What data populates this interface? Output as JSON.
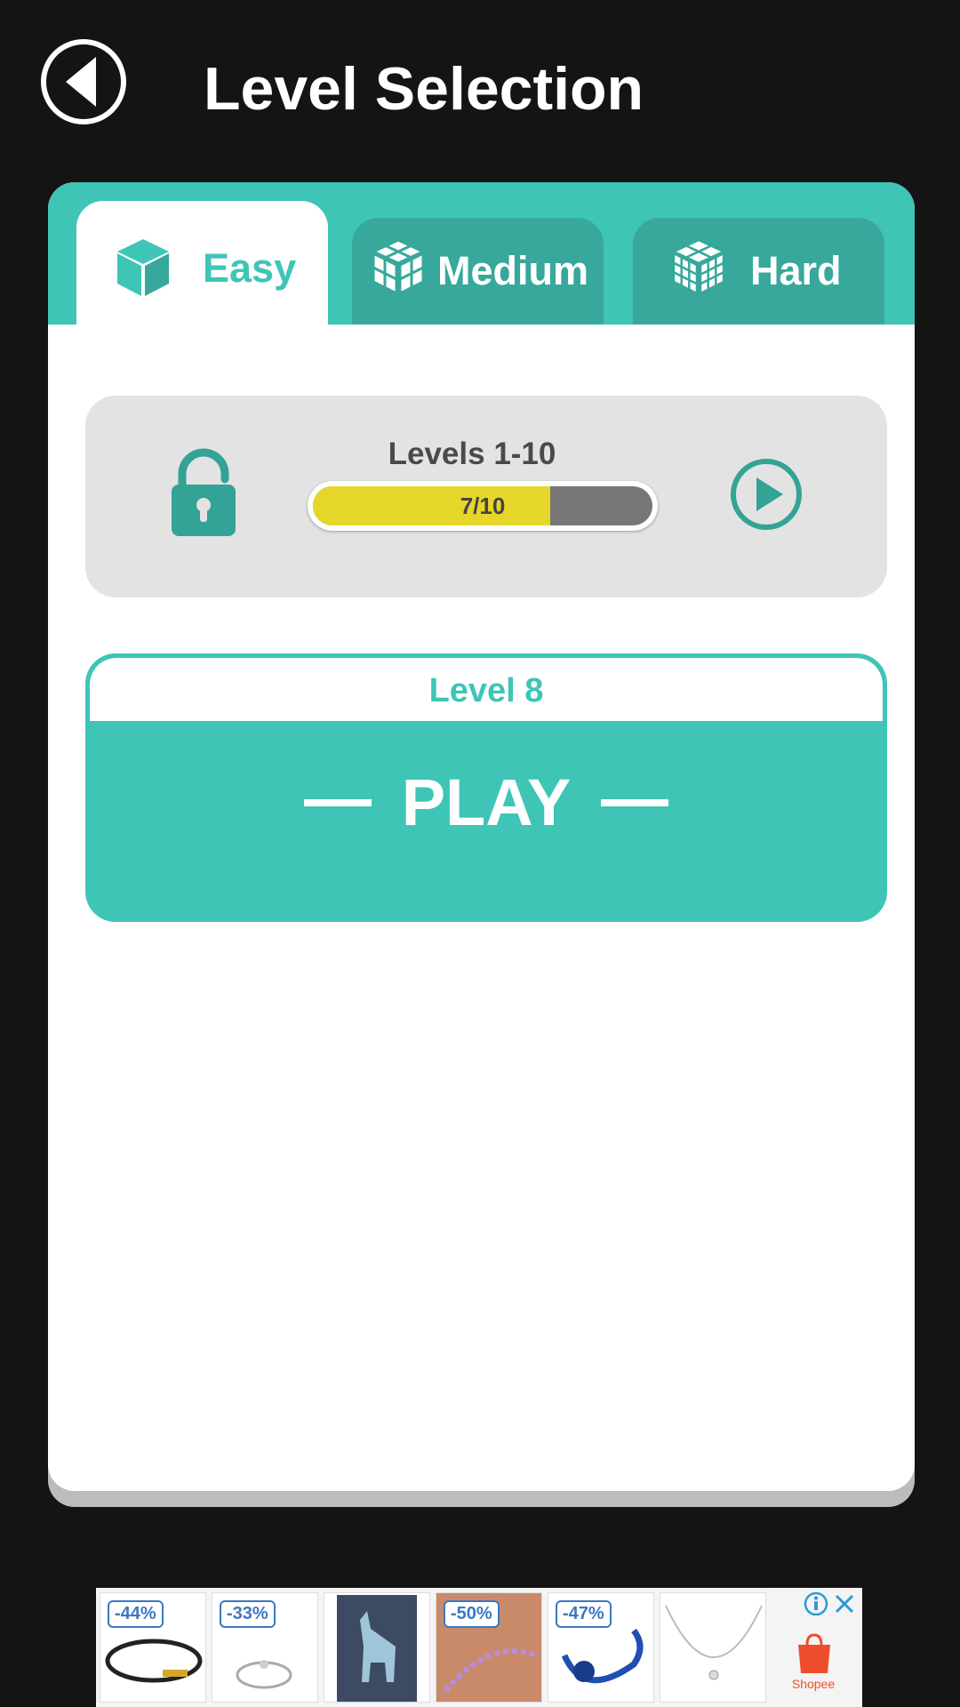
{
  "header": {
    "title": "Level Selection",
    "back_icon": "back-arrow-circle-icon"
  },
  "tabs": [
    {
      "label": "Easy",
      "icon": "cube-icon",
      "active": true
    },
    {
      "label": "Medium",
      "icon": "cube-2x2-icon",
      "active": false
    },
    {
      "label": "Hard",
      "icon": "cube-3x3-icon",
      "active": false
    }
  ],
  "level_group": {
    "title": "Levels 1-10",
    "lock_icon": "unlocked-padlock-icon",
    "progress_text": "7/10",
    "progress_fraction": 0.7,
    "play_icon": "play-circle-icon"
  },
  "next_level": {
    "title": "Level 8",
    "play_label": "PLAY"
  },
  "ad": {
    "items": [
      {
        "badge": "-44%",
        "product": "black leather bracelet"
      },
      {
        "badge": "-33%",
        "product": "silver ring"
      },
      {
        "badge": "",
        "product": "llama pin"
      },
      {
        "badge": "-50%",
        "product": "beaded bracelet"
      },
      {
        "badge": "-47%",
        "product": "blue beaded bracelet"
      },
      {
        "badge": "",
        "product": "silver necklace"
      }
    ],
    "brand": "Shopee",
    "info_icon": "info-icon",
    "close_icon": "close-icon"
  },
  "colors": {
    "accent": "#3ec5b6",
    "accent_dark": "#37a89b",
    "progress_fill": "#e7d62a",
    "background": "#141414"
  }
}
